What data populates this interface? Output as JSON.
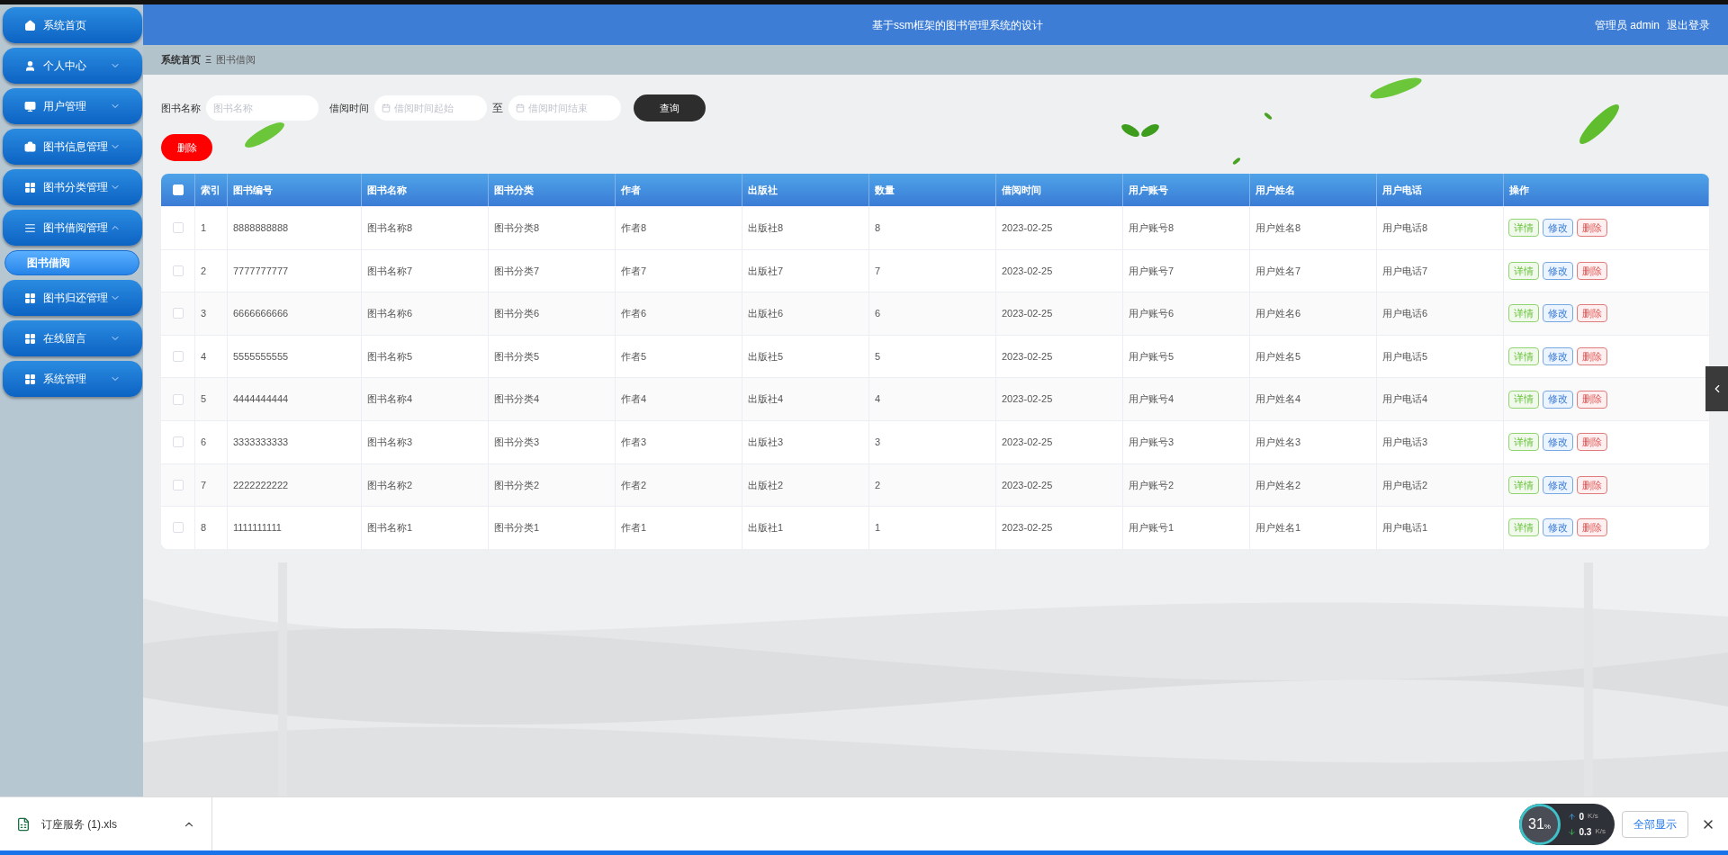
{
  "sidebar": {
    "items": [
      {
        "label": "系统首页",
        "has_caret": false
      },
      {
        "label": "个人中心",
        "expanded": false,
        "has_caret": true
      },
      {
        "label": "用户管理",
        "expanded": false,
        "has_caret": true
      },
      {
        "label": "图书信息管理",
        "expanded": false,
        "has_caret": true
      },
      {
        "label": "图书分类管理",
        "expanded": false,
        "has_caret": true
      },
      {
        "label": "图书借阅管理",
        "expanded": true,
        "has_caret": true,
        "children": [
          {
            "label": "图书借阅",
            "selected": true
          }
        ]
      },
      {
        "label": "图书归还管理",
        "expanded": false,
        "has_caret": true
      },
      {
        "label": "在线留言",
        "expanded": false,
        "has_caret": true
      },
      {
        "label": "系统管理",
        "expanded": false,
        "has_caret": true
      }
    ]
  },
  "header": {
    "title": "基于ssm框架的图书管理系统的设计",
    "user": "管理员 admin",
    "logout": "退出登录"
  },
  "breadcrumb": {
    "home": "系统首页",
    "separator": "Ξ",
    "current": "图书借阅"
  },
  "search": {
    "name_label": "图书名称",
    "name_placeholder": "图书名称",
    "time_label": "借阅时间",
    "start_placeholder": "借阅时间起始",
    "to": "至",
    "end_placeholder": "借阅时间结束",
    "query_button": "查询"
  },
  "delete_button": "删除",
  "table": {
    "header_checked": false,
    "columns": [
      "索引",
      "图书编号",
      "图书名称",
      "图书分类",
      "作者",
      "出版社",
      "数量",
      "借阅时间",
      "用户账号",
      "用户姓名",
      "用户电话",
      "操作"
    ],
    "rows": [
      {
        "checked": false,
        "cells": [
          "1",
          "8888888888",
          "图书名称8",
          "图书分类8",
          "作者8",
          "出版社8",
          "8",
          "2023-02-25",
          "用户账号8",
          "用户姓名8",
          "用户电话8"
        ],
        "actions": [
          "详情",
          "修改",
          "删除"
        ]
      },
      {
        "checked": false,
        "cells": [
          "2",
          "7777777777",
          "图书名称7",
          "图书分类7",
          "作者7",
          "出版社7",
          "7",
          "2023-02-25",
          "用户账号7",
          "用户姓名7",
          "用户电话7"
        ],
        "actions": [
          "详情",
          "修改",
          "删除"
        ]
      },
      {
        "checked": false,
        "cells": [
          "3",
          "6666666666",
          "图书名称6",
          "图书分类6",
          "作者6",
          "出版社6",
          "6",
          "2023-02-25",
          "用户账号6",
          "用户姓名6",
          "用户电话6"
        ],
        "actions": [
          "详情",
          "修改",
          "删除"
        ]
      },
      {
        "checked": false,
        "cells": [
          "4",
          "5555555555",
          "图书名称5",
          "图书分类5",
          "作者5",
          "出版社5",
          "5",
          "2023-02-25",
          "用户账号5",
          "用户姓名5",
          "用户电话5"
        ],
        "actions": [
          "详情",
          "修改",
          "删除"
        ]
      },
      {
        "checked": false,
        "cells": [
          "5",
          "4444444444",
          "图书名称4",
          "图书分类4",
          "作者4",
          "出版社4",
          "4",
          "2023-02-25",
          "用户账号4",
          "用户姓名4",
          "用户电话4"
        ],
        "actions": [
          "详情",
          "修改",
          "删除"
        ]
      },
      {
        "checked": false,
        "cells": [
          "6",
          "3333333333",
          "图书名称3",
          "图书分类3",
          "作者3",
          "出版社3",
          "3",
          "2023-02-25",
          "用户账号3",
          "用户姓名3",
          "用户电话3"
        ],
        "actions": [
          "详情",
          "修改",
          "删除"
        ]
      },
      {
        "checked": false,
        "cells": [
          "7",
          "2222222222",
          "图书名称2",
          "图书分类2",
          "作者2",
          "出版社2",
          "2",
          "2023-02-25",
          "用户账号2",
          "用户姓名2",
          "用户电话2"
        ],
        "actions": [
          "详情",
          "修改",
          "删除"
        ]
      },
      {
        "checked": false,
        "cells": [
          "8",
          "1111111111",
          "图书名称1",
          "图书分类1",
          "作者1",
          "出版社1",
          "1",
          "2023-02-25",
          "用户账号1",
          "用户姓名1",
          "用户电话1"
        ],
        "actions": [
          "详情",
          "修改",
          "删除"
        ]
      }
    ]
  },
  "download_bar": {
    "file": "订座服务 (1).xls",
    "show_all": "全部显示"
  },
  "net_monitor": {
    "percent": "31",
    "percent_unit": "%",
    "up": "0",
    "up_unit": "K/s",
    "down": "0.3",
    "down_unit": "K/s"
  }
}
